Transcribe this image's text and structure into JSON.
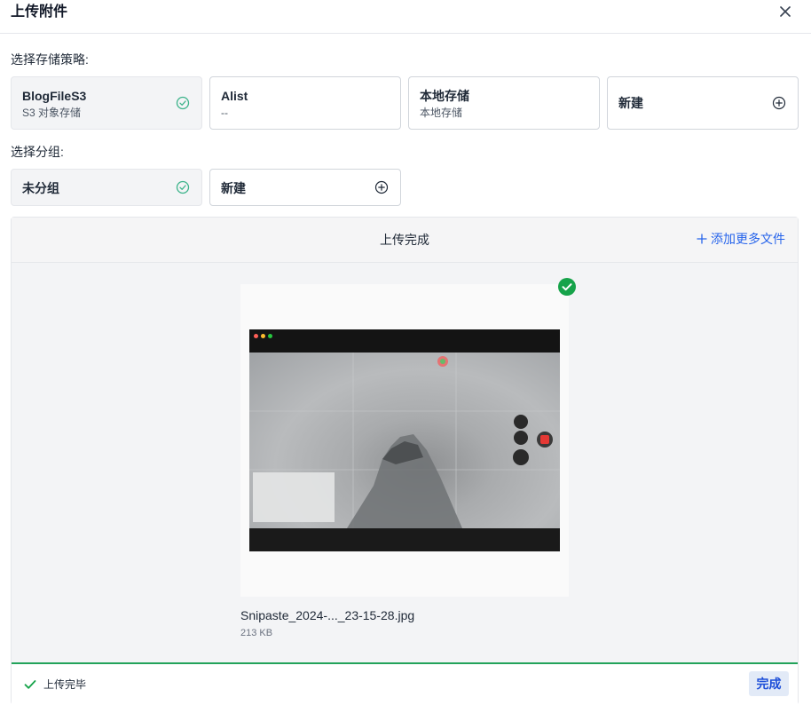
{
  "dialog": {
    "title": "上传附件",
    "close_icon": "close-icon"
  },
  "storage": {
    "label": "选择存储策略:",
    "policies": [
      {
        "name": "BlogFileS3",
        "desc": "S3 对象存储",
        "selected": true
      },
      {
        "name": "Alist",
        "desc": "--",
        "selected": false
      },
      {
        "name": "本地存储",
        "desc": "本地存储",
        "selected": false
      }
    ],
    "new_label": "新建"
  },
  "group": {
    "label": "选择分组:",
    "groups": [
      {
        "name": "未分组",
        "selected": true
      }
    ],
    "new_label": "新建"
  },
  "upload": {
    "status": "上传完成",
    "add_more": "添加更多文件",
    "file": {
      "name": "Snipaste_2024-..._23-15-28.jpg",
      "size": "213 KB"
    },
    "progress": 1.0,
    "footer_status": "上传完毕",
    "finish_label": "完成"
  },
  "colors": {
    "accent": "#2563eb",
    "success": "#22a35a",
    "check_selected": "#3cb38a"
  }
}
